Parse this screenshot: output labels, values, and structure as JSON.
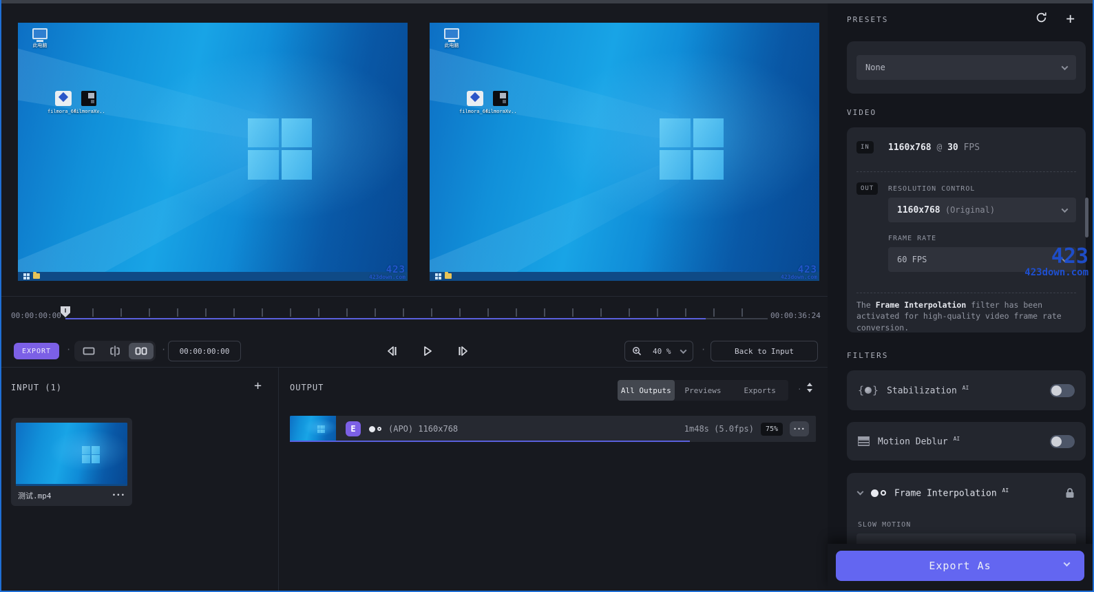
{
  "icons": {
    "plus": "+",
    "dots_menu": "•••",
    "dot_sep": "·"
  },
  "watermark": {
    "line1": "423",
    "line2": "423down.com"
  },
  "preview": {
    "this_pc_label": "此电脑",
    "file1_label": "filmora_64..",
    "file2_label": "filmoraXv.."
  },
  "timeline": {
    "start_time": "00:00:00:00",
    "end_time": "00:00:36:24",
    "progress_style": "width:91.2%"
  },
  "controls": {
    "export_label": "EXPORT",
    "timecode": "00:00:00:00",
    "zoom_value": "40 %",
    "back_label": "Back to Input"
  },
  "input_panel": {
    "title": "INPUT (1)",
    "file": {
      "name": "测试.mp4"
    }
  },
  "output_panel": {
    "title": "OUTPUT",
    "tabs": {
      "all": "All Outputs",
      "previews": "Previews",
      "exports": "Exports"
    },
    "row": {
      "badge": "E",
      "label": "(APO) 1160x768",
      "duration": "1m48s (5.0fps)",
      "percent": "75%",
      "progress_style": "width:76%"
    }
  },
  "sidebar": {
    "presets": {
      "title": "PRESETS",
      "value": "None"
    },
    "video": {
      "title": "VIDEO",
      "in_badge": "IN",
      "in_res": "1160x768",
      "in_at": "@",
      "in_fps": "30",
      "in_unit": "FPS",
      "out_badge": "OUT",
      "resolution_label": "RESOLUTION CONTROL",
      "resolution_value": "1160x768",
      "resolution_note": "(Original)",
      "framerate_label": "FRAME RATE",
      "framerate_value": "60 FPS",
      "notice_prefix": "The ",
      "notice_bold": "Frame Interpolation",
      "notice_suffix": " filter has been activated for high-quality video frame rate conversion."
    },
    "filters": {
      "title": "FILTERS",
      "stabilization": {
        "label": "Stabilization",
        "sup": "AI"
      },
      "motion_deblur": {
        "label": "Motion Deblur",
        "sup": "AI"
      },
      "frame_interpolation": {
        "label": "Frame Interpolation",
        "sup": "AI",
        "slow_motion_label": "SLOW MOTION"
      }
    },
    "export_button": "Export As"
  }
}
